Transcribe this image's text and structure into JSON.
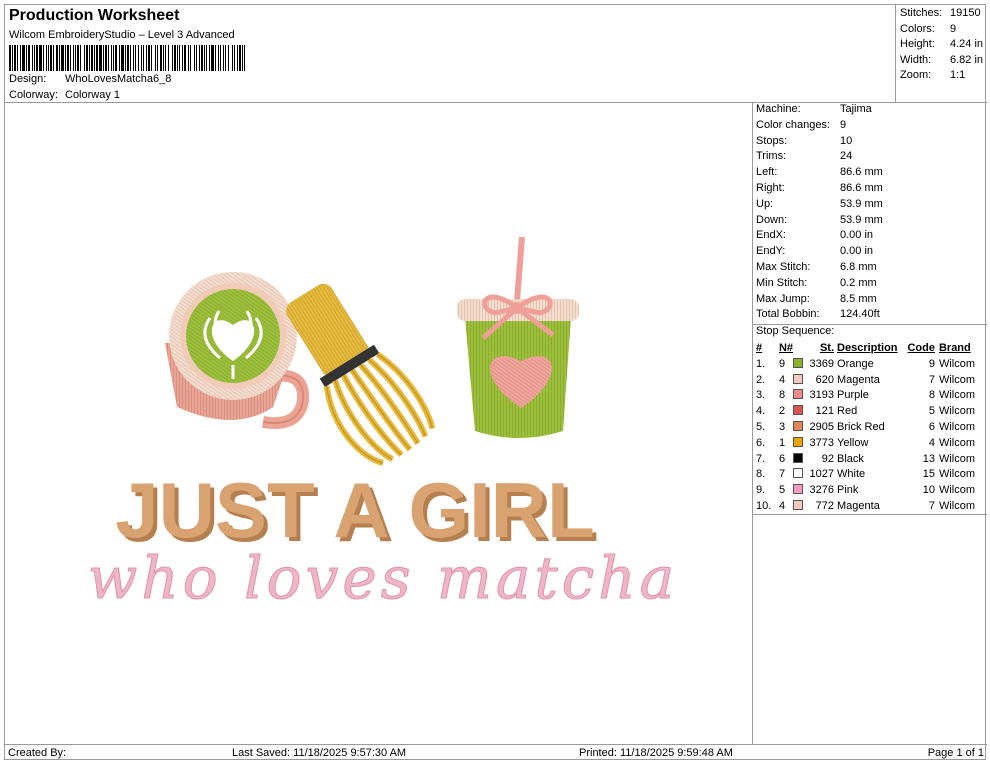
{
  "header": {
    "title": "Production Worksheet",
    "subtitle": "Wilcom EmbroideryStudio – Level 3 Advanced",
    "design_label": "Design:",
    "design_value": "WhoLovesMatcha6_8",
    "colorway_label": "Colorway:",
    "colorway_value": "Colorway 1"
  },
  "summary": [
    {
      "label": "Stitches:",
      "value": "19150"
    },
    {
      "label": "Colors:",
      "value": "9"
    },
    {
      "label": "Height:",
      "value": "4.24 in"
    },
    {
      "label": "Width:",
      "value": "6.82 in"
    },
    {
      "label": "Zoom:",
      "value": "1:1"
    }
  ],
  "machine_info": [
    {
      "label": "Machine:",
      "value": "Tajima"
    },
    {
      "label": "Color changes:",
      "value": "9"
    },
    {
      "label": "Stops:",
      "value": "10"
    },
    {
      "label": "Trims:",
      "value": "24"
    },
    {
      "label": "Left:",
      "value": "86.6 mm"
    },
    {
      "label": "Right:",
      "value": "86.6 mm"
    },
    {
      "label": "Up:",
      "value": "53.9 mm"
    },
    {
      "label": "Down:",
      "value": "53.9 mm"
    },
    {
      "label": "EndX:",
      "value": "0.00 in"
    },
    {
      "label": "EndY:",
      "value": "0.00 in"
    },
    {
      "label": "Max Stitch:",
      "value": "6.8 mm"
    },
    {
      "label": "Min Stitch:",
      "value": "0.2 mm"
    },
    {
      "label": "Max Jump:",
      "value": "8.5 mm"
    },
    {
      "label": "Total Bobbin:",
      "value": "124.40ft"
    }
  ],
  "stop_sequence": {
    "title": "Stop Sequence:",
    "headers": {
      "num": "#",
      "n": "N#",
      "st": "St.",
      "desc": "Description",
      "code": "Code",
      "brand": "Brand"
    },
    "rows": [
      {
        "num": "1.",
        "n": "9",
        "color": "#8db32c",
        "st": "3369",
        "desc": "Orange",
        "code": "9",
        "brand": "Wilcom"
      },
      {
        "num": "2.",
        "n": "4",
        "color": "#f6c7c0",
        "st": "620",
        "desc": "Magenta",
        "code": "7",
        "brand": "Wilcom"
      },
      {
        "num": "3.",
        "n": "8",
        "color": "#f08a8c",
        "st": "3193",
        "desc": "Purple",
        "code": "8",
        "brand": "Wilcom"
      },
      {
        "num": "4.",
        "n": "2",
        "color": "#d9534f",
        "st": "121",
        "desc": "Red",
        "code": "5",
        "brand": "Wilcom"
      },
      {
        "num": "5.",
        "n": "3",
        "color": "#e0875a",
        "st": "2905",
        "desc": "Brick Red",
        "code": "6",
        "brand": "Wilcom"
      },
      {
        "num": "6.",
        "n": "1",
        "color": "#f0a500",
        "st": "3773",
        "desc": "Yellow",
        "code": "4",
        "brand": "Wilcom"
      },
      {
        "num": "7.",
        "n": "6",
        "color": "#000000",
        "st": "92",
        "desc": "Black",
        "code": "13",
        "brand": "Wilcom"
      },
      {
        "num": "8.",
        "n": "7",
        "color": "#ffffff",
        "st": "1027",
        "desc": "White",
        "code": "15",
        "brand": "Wilcom"
      },
      {
        "num": "9.",
        "n": "5",
        "color": "#f59ac3",
        "st": "3276",
        "desc": "Pink",
        "code": "10",
        "brand": "Wilcom"
      },
      {
        "num": "10.",
        "n": "4",
        "color": "#f6c7c0",
        "st": "772",
        "desc": "Magenta",
        "code": "7",
        "brand": "Wilcom"
      }
    ]
  },
  "design_art": {
    "headline": "JUST A GIRL",
    "script": "who loves matcha",
    "colors": {
      "matcha": "#9cbf3a",
      "cup_pink": "#eba393",
      "cup_rim": "#f7dccc",
      "whisk": "#e6b93a",
      "whisk_dark": "#c4911c",
      "band": "#333333",
      "letters": "#d9a271",
      "letters_shadow": "#b67f4f",
      "script_pink": "#f0b6c6",
      "bow": "#ef9f98",
      "heart": "#f2a39a"
    }
  },
  "footer": {
    "created_by": "Created By:",
    "last_saved": "Last Saved: 11/18/2025 9:57:30 AM",
    "printed": "Printed: 11/18/2025 9:59:48 AM",
    "page": "Page 1 of 1"
  }
}
